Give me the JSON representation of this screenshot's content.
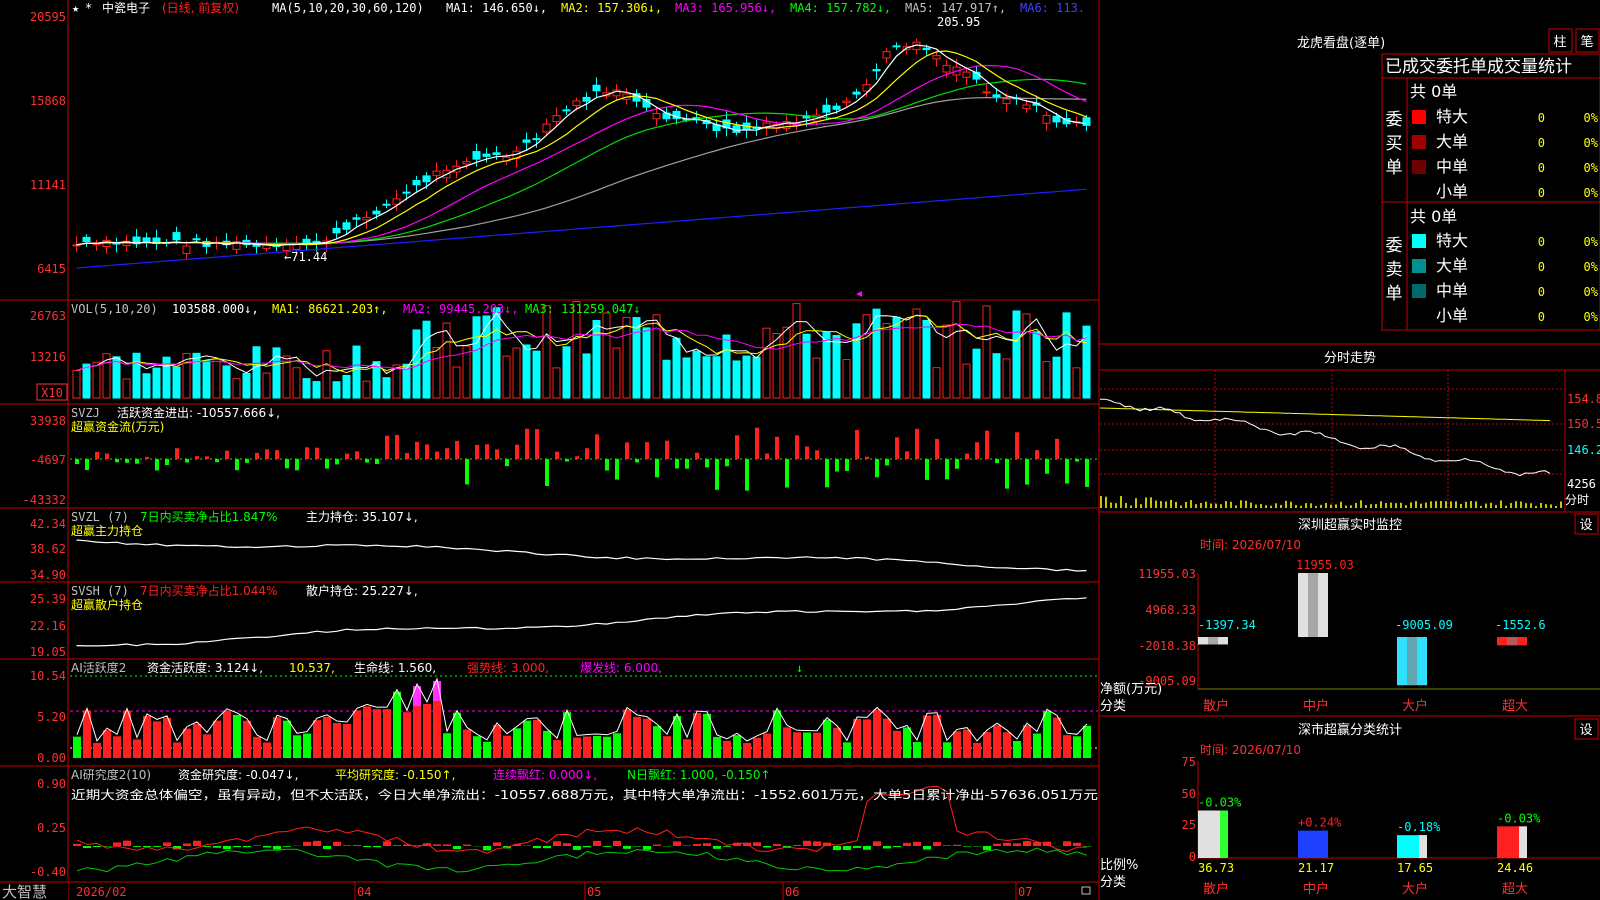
{
  "colors": {
    "up": "#ff2020",
    "down": "#00ffff",
    "grid": "#c00000",
    "axis": "#ff3030",
    "ma1": "#ffffff",
    "ma2": "#ffff00",
    "ma3": "#ff00ff",
    "ma4": "#00ff00",
    "ma5": "#a0a0a0",
    "ma6": "#2020ff"
  },
  "main": {
    "stock": "中瓷电子",
    "mode": "(日线, 前复权)",
    "ma_spec": "MA(5,10,20,30,60,120)",
    "ma1": "MA1: 146.650↓,",
    "ma2": "MA2: 157.306↓,",
    "ma3": "MA3: 165.956↓,",
    "ma4": "MA4: 157.782↓,",
    "ma5": "MA5: 147.917↑,",
    "ma6": "MA6: 113.",
    "high_label": "205.95",
    "low_label": "←71.44",
    "yticks": [
      "20595",
      "15868",
      "11141",
      "6415"
    ]
  },
  "vol": {
    "spec": "VOL(5,10,20)",
    "value": "103588.000↓,",
    "ma1": "MA1: 86621.203↑,",
    "ma2": "MA2: 99445.203↓,",
    "ma3": "MA3: 131259.047↓",
    "yticks": [
      "26763",
      "13216"
    ],
    "unit": "X10"
  },
  "svzj": {
    "spec": "SVZJ",
    "line": "活跃资金进出: -10557.666↓,",
    "title": "超赢资金流(万元)",
    "yticks": [
      "33938",
      "-4697",
      "-43332"
    ]
  },
  "svzl": {
    "spec": "SVZL (7)",
    "line1": "7日内买卖净占比1.847%",
    "line2": "主力持仓: 35.107↓,",
    "title": "超赢主力持仓",
    "yticks": [
      "42.34",
      "38.62",
      "34.90"
    ]
  },
  "svsh": {
    "spec": "SVSH (7)",
    "line1": "7日内买卖净占比1.044%",
    "line2": "散户持仓: 25.227↓,",
    "title": "超赢散户持仓",
    "yticks": [
      "25.39",
      "22.16",
      "19.05"
    ]
  },
  "ai1": {
    "spec": "AI活跃度2",
    "a": "资金活跃度: 3.124↓,",
    "b": "10.537,",
    "c": "生命线: 1.560,",
    "d": "强势线: 3.000,",
    "e": "爆发线: 6.000,",
    "yticks": [
      "10.54",
      "5.20",
      "0.00"
    ]
  },
  "ai2": {
    "spec": "AI研究度2(10)",
    "a": "资金研究度: -0.047↓,",
    "b": "平均研究度: -0.150↑,",
    "c": "连续飘红: 0.000↓,",
    "d": "N日飘红: 1.000, -0.150↑",
    "comment": "近期大资金总体偏空，虽有异动，但不太活跃，今日大单净流出：-10557.688万元，其中特大单净流出：-1552.601万元，大单5日累计净出-57636.051万元",
    "yticks": [
      "0.90",
      "0.25",
      "-0.40"
    ]
  },
  "xaxis": {
    "brand": "大智慧",
    "labels": [
      "2026/02",
      "04",
      "05",
      "06",
      "07"
    ]
  },
  "lhb": {
    "title": "龙虎看盘(逐单)",
    "btn1": "柱",
    "btn2": "笔",
    "header": "已成交委托单成交量统计",
    "buy_label": "委买单",
    "sell_label": "委卖单",
    "buy_total": "共 0单",
    "sell_total": "共 0单",
    "buy_rows": [
      {
        "name": "特大",
        "count": "0",
        "pct": "0%",
        "color": "#ff0000"
      },
      {
        "name": "大单",
        "count": "0",
        "pct": "0%",
        "color": "#a00000"
      },
      {
        "name": "中单",
        "count": "0",
        "pct": "0%",
        "color": "#700000"
      },
      {
        "name": "小单",
        "count": "0",
        "pct": "0%",
        "color": "#000000"
      }
    ],
    "sell_rows": [
      {
        "name": "特大",
        "count": "0",
        "pct": "0%",
        "color": "#00ffff"
      },
      {
        "name": "大单",
        "count": "0",
        "pct": "0%",
        "color": "#009090"
      },
      {
        "name": "中单",
        "count": "0",
        "pct": "0%",
        "color": "#006a6a"
      },
      {
        "name": "小单",
        "count": "0",
        "pct": "0%",
        "color": "#000000"
      }
    ]
  },
  "fenshi": {
    "title": "分时走势",
    "yticks": [
      "154.8",
      "150.5",
      "146.2",
      "4256"
    ],
    "unit": "分时"
  },
  "monitor": {
    "title": "深圳超赢实时监控",
    "btn": "设",
    "time": "时间: 2026/07/10",
    "yticks": [
      "11955.03",
      "4968.33",
      "-2018.38",
      "-9005.09"
    ],
    "ylabel": "净额(万元)",
    "xlabel": "分类",
    "cats": [
      "散户",
      "中户",
      "大户",
      "超大"
    ],
    "values": [
      "-1397.34",
      "11955.03",
      "-9005.09",
      "-1552.6"
    ]
  },
  "fenlei": {
    "title": "深市超赢分类统计",
    "btn": "设",
    "time": "时间: 2026/07/10",
    "yticks": [
      "75",
      "50",
      "25",
      "0"
    ],
    "ylabel": "比例%",
    "xlabel": "分类",
    "cats": [
      "散户",
      "中户",
      "大户",
      "超大"
    ],
    "values": [
      "36.73",
      "21.17",
      "17.65",
      "24.46"
    ],
    "changes": [
      "-0.03%",
      "+0.24%",
      "-0.18%",
      "-0.03%"
    ]
  }
}
